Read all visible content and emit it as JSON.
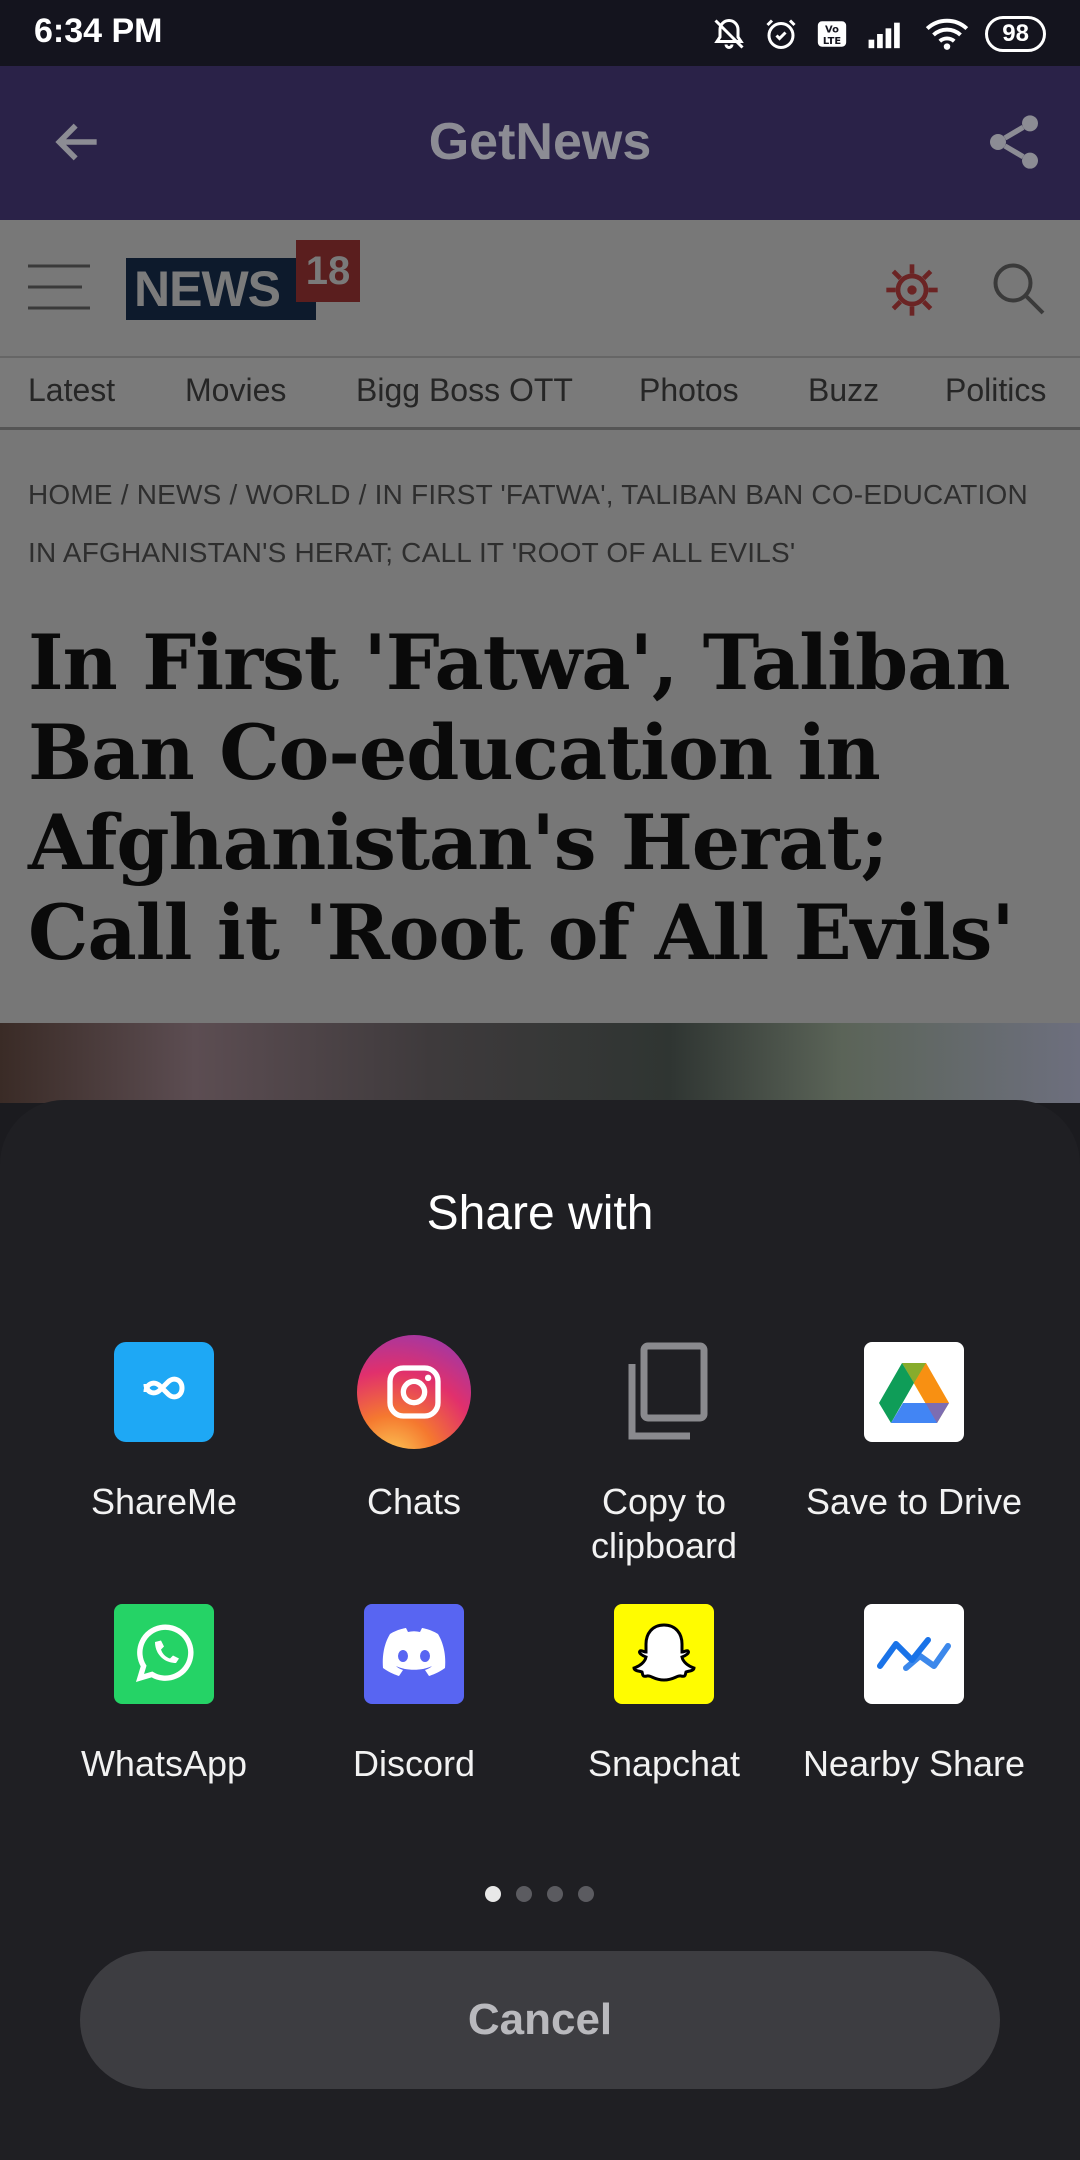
{
  "status_bar": {
    "time": "6:34 PM",
    "battery": "98"
  },
  "app_bar": {
    "title": "GetNews"
  },
  "site": {
    "logo_text": "NEWS",
    "logo_badge": "18",
    "nav_items": [
      "Latest",
      "Movies",
      "Bigg Boss OTT",
      "Photos",
      "Buzz",
      "Politics"
    ],
    "breadcrumb": "HOME / NEWS / WORLD / IN FIRST 'FATWA', TALIBAN BAN CO-EDUCATION IN AFGHANISTAN'S HERAT; CALL IT 'ROOT OF ALL EVILS'",
    "headline": "In First 'Fatwa', Taliban Ban Co-education in Afghanistan's Herat; Call it 'Root of All Evils'"
  },
  "share_sheet": {
    "title": "Share with",
    "apps": [
      {
        "label": "ShareMe",
        "icon": "shareme-icon",
        "color": "#1ea8f5"
      },
      {
        "label": "Chats",
        "icon": "instagram-icon",
        "color": "#e1306c"
      },
      {
        "label": "Copy to clipboard",
        "icon": "copy-icon",
        "color": "#8a8a8e"
      },
      {
        "label": "Save to Drive",
        "icon": "google-drive-icon",
        "color": "#ffffff"
      },
      {
        "label": "WhatsApp",
        "icon": "whatsapp-icon",
        "color": "#25d366"
      },
      {
        "label": "Discord",
        "icon": "discord-icon",
        "color": "#5865f2"
      },
      {
        "label": "Snapchat",
        "icon": "snapchat-icon",
        "color": "#fffc00"
      },
      {
        "label": "Nearby Share",
        "icon": "nearby-share-icon",
        "color": "#ffffff"
      }
    ],
    "page_count": 4,
    "current_page": 1,
    "cancel_label": "Cancel"
  }
}
